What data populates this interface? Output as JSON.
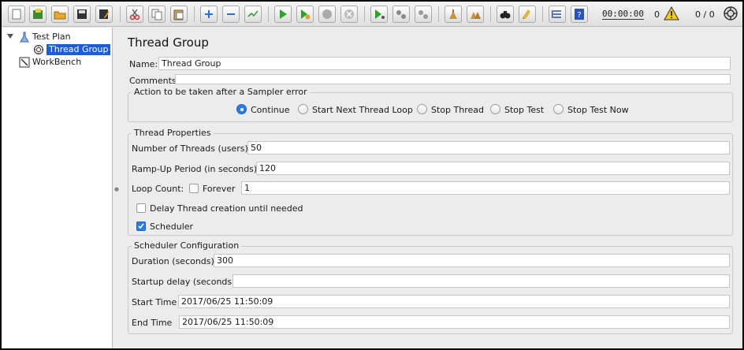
{
  "toolbar": {
    "icons": [
      "new-icon",
      "templates-icon",
      "open-icon",
      "save-icon",
      "save-as-icon",
      "cut-icon",
      "copy-icon",
      "paste-icon",
      "expand-icon",
      "collapse-icon",
      "toggle-icon",
      "start-icon",
      "start-no-timers-icon",
      "stop-icon",
      "shutdown-icon",
      "remote-start-icon",
      "remote-stop-icon",
      "remote-shutdown-icon",
      "clear-icon",
      "clear-all-icon",
      "search-icon",
      "reset-search-icon",
      "function-helper-icon",
      "help-icon"
    ],
    "timer": "00:00:00",
    "error_count": "0",
    "thread_count": "0 / 0",
    "accent": "#2d7ce3"
  },
  "tree": {
    "test_plan": "Test Plan",
    "thread_group": "Thread Group",
    "workbench": "WorkBench"
  },
  "main": {
    "title": "Thread Group",
    "name_label": "Name:",
    "name_value": "Thread Group",
    "comments_label": "Comments:",
    "comments_value": "",
    "sampler_error": {
      "title": "Action to be taken after a Sampler error",
      "options": [
        "Continue",
        "Start Next Thread Loop",
        "Stop Thread",
        "Stop Test",
        "Stop Test Now"
      ],
      "selected": "Continue"
    },
    "thread_properties": {
      "title": "Thread Properties",
      "threads_label": "Number of Threads (users):",
      "threads_value": "50",
      "rampup_label": "Ramp-Up Period (in seconds):",
      "rampup_value": "120",
      "loop_label": "Loop Count:",
      "forever_label": "Forever",
      "forever_checked": false,
      "loop_value": "1",
      "delay_label": "Delay Thread creation until needed",
      "delay_checked": false,
      "scheduler_label": "Scheduler",
      "scheduler_checked": true
    },
    "scheduler_config": {
      "title": "Scheduler Configuration",
      "duration_label": "Duration (seconds)",
      "duration_value": "300",
      "startup_label": "Startup delay (seconds)",
      "startup_value": "",
      "start_label": "Start Time",
      "start_value": "2017/06/25 11:50:09",
      "end_label": "End Time",
      "end_value": "2017/06/25 11:50:09"
    }
  }
}
